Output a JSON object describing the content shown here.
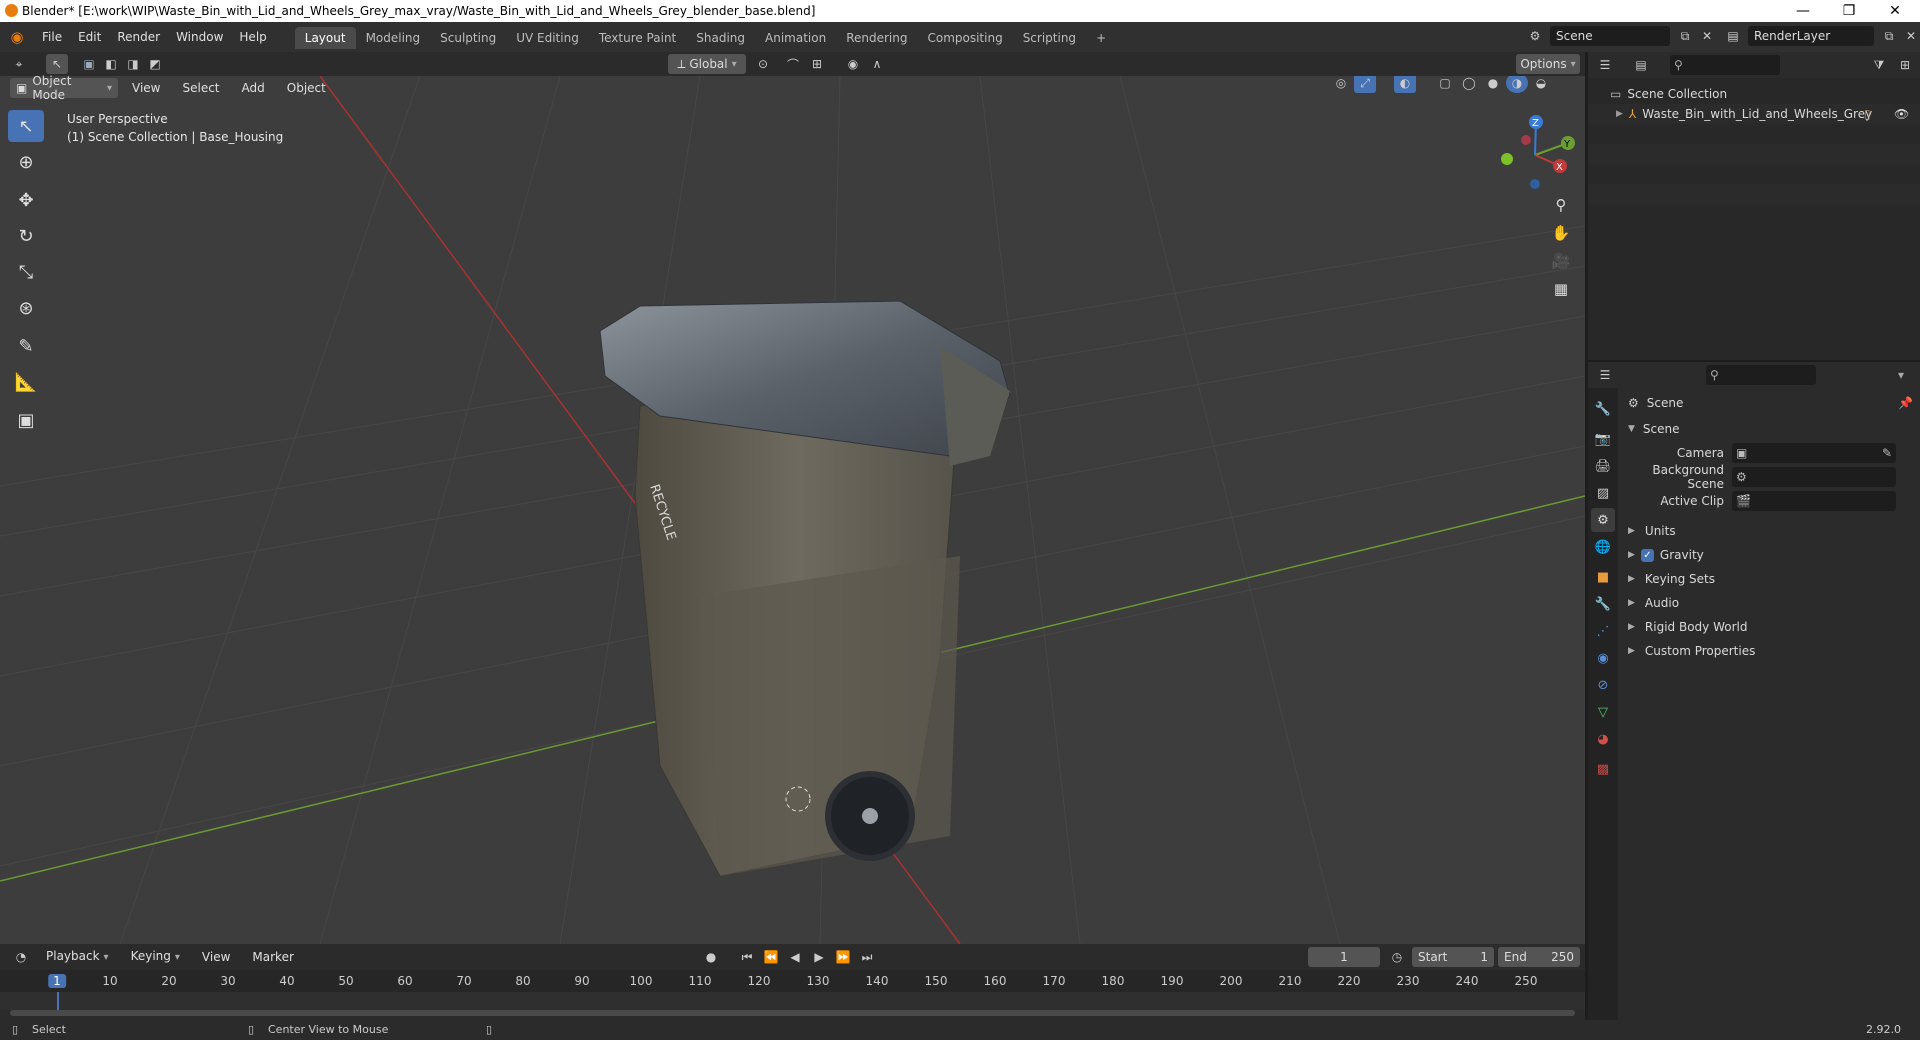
{
  "window": {
    "title": "Blender* [E:\\work\\WIP\\Waste_Bin_with_Lid_and_Wheels_Grey_max_vray/Waste_Bin_with_Lid_and_Wheels_Grey_blender_base.blend]",
    "minimize": "—",
    "restore": "❐",
    "close": "✕"
  },
  "menu": [
    "File",
    "Edit",
    "Render",
    "Window",
    "Help"
  ],
  "workspaces": [
    "Layout",
    "Modeling",
    "Sculpting",
    "UV Editing",
    "Texture Paint",
    "Shading",
    "Animation",
    "Rendering",
    "Compositing",
    "Scripting"
  ],
  "add_workspace": "+",
  "scene_name": "Scene",
  "render_layer": "RenderLayer",
  "viewport_header": {
    "transform_orientation": "Global",
    "options": "Options",
    "mode": "Object Mode",
    "menus": [
      "View",
      "Select",
      "Add",
      "Object"
    ]
  },
  "overlay": {
    "line1": "User Perspective",
    "line2": "(1) Scene Collection | Base_Housing"
  },
  "gizmo": {
    "z": "Z",
    "y": "Y",
    "x": "X"
  },
  "bin_label": "RECYCLE",
  "outliner": {
    "root": "Scene Collection",
    "item": "Waste_Bin_with_Lid_and_Wheels_Grey"
  },
  "properties": {
    "context": "Scene",
    "panel": "Scene",
    "fields": [
      {
        "label": "Camera"
      },
      {
        "label": "Background Scene"
      },
      {
        "label": "Active Clip"
      }
    ],
    "sections": [
      "Units",
      "Gravity",
      "Keying Sets",
      "Audio",
      "Rigid Body World",
      "Custom Properties"
    ],
    "gravity_checked": true
  },
  "timeline": {
    "menus": [
      "Playback",
      "Keying",
      "View",
      "Marker"
    ],
    "current_frame": "1",
    "start_label": "Start",
    "start": "1",
    "end_label": "End",
    "end": "250",
    "ticks": [
      "1",
      "10",
      "20",
      "30",
      "40",
      "50",
      "60",
      "70",
      "80",
      "90",
      "100",
      "110",
      "120",
      "130",
      "140",
      "150",
      "160",
      "170",
      "180",
      "190",
      "200",
      "210",
      "220",
      "230",
      "240",
      "250"
    ]
  },
  "status": {
    "left": "Select",
    "middle": "Center View to Mouse",
    "version": "2.92.0"
  },
  "colors": {
    "accent": "#4772b3",
    "x_axis": "#c23a3a",
    "y_axis": "#6aa032",
    "z_axis": "#3a7bd5"
  }
}
